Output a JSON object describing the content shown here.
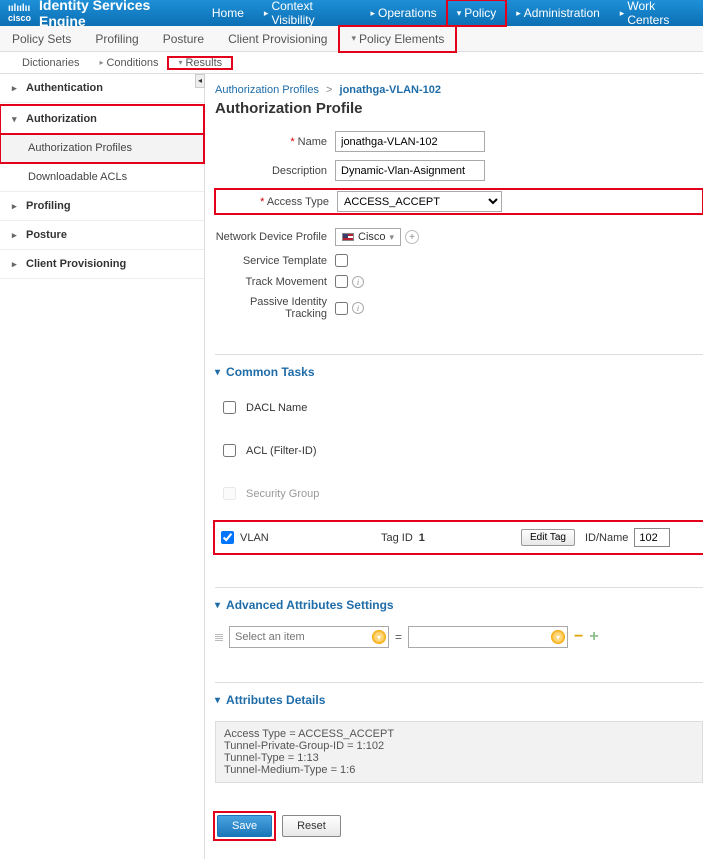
{
  "brand": {
    "logo_top": "ıılıılıı",
    "logo_bottom": "cisco",
    "title": "Identity Services Engine"
  },
  "topnav": {
    "home": "Home",
    "context": "Context Visibility",
    "operations": "Operations",
    "policy": "Policy",
    "admin": "Administration",
    "work": "Work Centers"
  },
  "subnav": {
    "policy_sets": "Policy Sets",
    "profiling": "Profiling",
    "posture": "Posture",
    "client_prov": "Client Provisioning",
    "policy_elements": "Policy Elements"
  },
  "thirdnav": {
    "dictionaries": "Dictionaries",
    "conditions": "Conditions",
    "results": "Results"
  },
  "sidebar": {
    "authentication": "Authentication",
    "authorization": "Authorization",
    "auth_profiles": "Authorization Profiles",
    "dl_acls": "Downloadable ACLs",
    "profiling": "Profiling",
    "posture": "Posture",
    "client_prov": "Client Provisioning",
    "collapse": "◂"
  },
  "breadcrumb": {
    "root": "Authorization Profiles",
    "current": "jonathga-VLAN-102"
  },
  "page_title": "Authorization Profile",
  "form": {
    "name_label": "Name",
    "name_value": "jonathga-VLAN-102",
    "desc_label": "Description",
    "desc_value": "Dynamic-Vlan-Asignment",
    "access_label": "Access Type",
    "access_value": "ACCESS_ACCEPT",
    "ndp_label": "Network Device Profile",
    "ndp_value": "Cisco",
    "ndp_arrow": "▾",
    "svc_tpl_label": "Service Template",
    "track_label": "Track Movement",
    "passive_label": "Passive Identity Tracking"
  },
  "common": {
    "header": "Common Tasks",
    "dacl": "DACL Name",
    "acl": "ACL (Filter-ID)",
    "sg": "Security Group",
    "vlan": "VLAN",
    "tag_label": "Tag ID",
    "tag_value": "1",
    "edit_tag": "Edit Tag",
    "idname_label": "ID/Name",
    "idname_value": "102"
  },
  "advanced": {
    "header": "Advanced Attributes Settings",
    "select_placeholder": "Select an item",
    "eq": "="
  },
  "details": {
    "header": "Attributes Details",
    "text": "Access Type = ACCESS_ACCEPT\nTunnel-Private-Group-ID = 1:102\nTunnel-Type = 1:13\nTunnel-Medium-Type = 1:6"
  },
  "buttons": {
    "save": "Save",
    "reset": "Reset"
  },
  "icons": {
    "info": "i",
    "plus": "+",
    "minus": "−",
    "dd": "▾"
  }
}
